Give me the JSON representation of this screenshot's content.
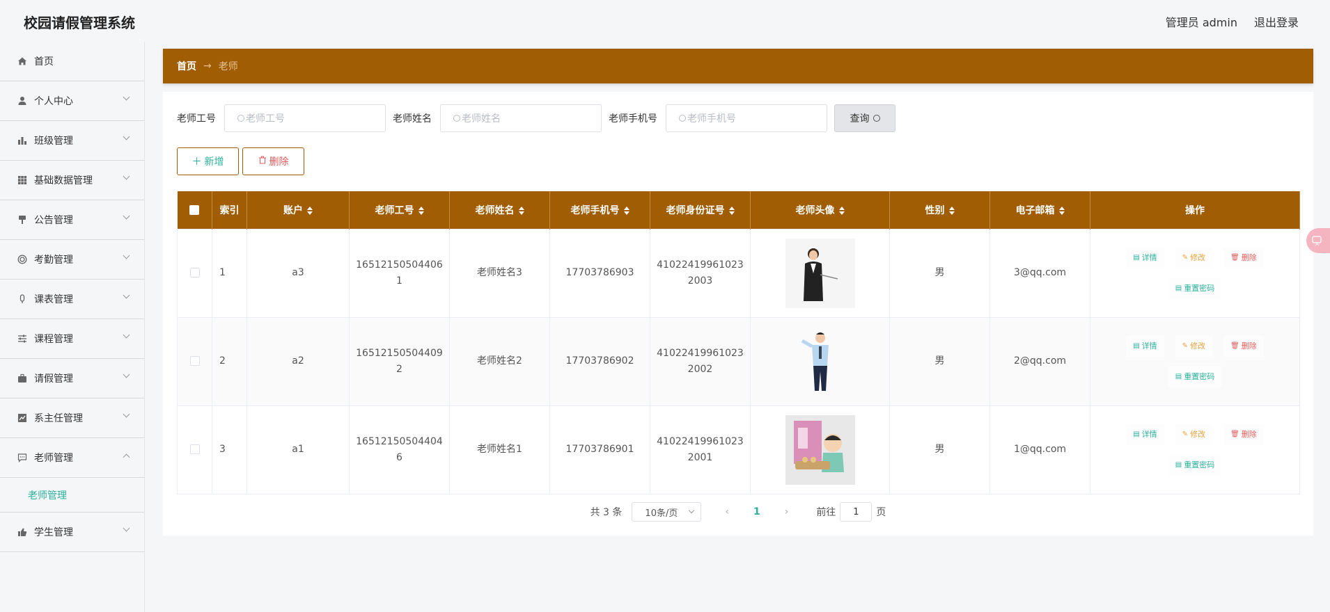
{
  "app": {
    "title": "校园请假管理系统"
  },
  "header": {
    "user": "管理员 admin",
    "logout": "退出登录"
  },
  "sidebar": {
    "items": [
      {
        "label": "首页",
        "icon": "home-icon"
      },
      {
        "label": "个人中心",
        "icon": "user-icon"
      },
      {
        "label": "班级管理",
        "icon": "bar-chart-icon"
      },
      {
        "label": "基础数据管理",
        "icon": "grid-icon"
      },
      {
        "label": "公告管理",
        "icon": "notice-icon"
      },
      {
        "label": "考勤管理",
        "icon": "circle-icon"
      },
      {
        "label": "课表管理",
        "icon": "mic-icon"
      },
      {
        "label": "课程管理",
        "icon": "sliders-icon"
      },
      {
        "label": "请假管理",
        "icon": "briefcase-icon"
      },
      {
        "label": "系主任管理",
        "icon": "trend-icon"
      },
      {
        "label": "老师管理",
        "icon": "chat-icon"
      },
      {
        "label": "学生管理",
        "icon": "thumb-icon"
      }
    ],
    "sub_active": "老师管理"
  },
  "breadcrumb": {
    "home": "首页",
    "sep": "→",
    "current": "老师"
  },
  "search": {
    "fields": [
      {
        "label": "老师工号",
        "placeholder": "老师工号"
      },
      {
        "label": "老师姓名",
        "placeholder": "老师姓名"
      },
      {
        "label": "老师手机号",
        "placeholder": "老师手机号"
      }
    ],
    "query_label": "查询"
  },
  "actions": {
    "add_label": "新增",
    "delete_label": "删除"
  },
  "table": {
    "headers": [
      "索引",
      "账户",
      "老师工号",
      "老师姓名",
      "老师手机号",
      "老师身份证号",
      "老师头像",
      "性别",
      "电子邮箱",
      "操作"
    ],
    "rows": [
      {
        "index": "1",
        "account": "a3",
        "teacher_no": "165121505044061",
        "name": "老师姓名3",
        "phone": "17703786903",
        "id_card": "410224199610232003",
        "gender": "男",
        "email": "3@qq.com"
      },
      {
        "index": "2",
        "account": "a2",
        "teacher_no": "165121505044092",
        "name": "老师姓名2",
        "phone": "17703786902",
        "id_card": "410224199610232002",
        "gender": "男",
        "email": "2@qq.com"
      },
      {
        "index": "3",
        "account": "a1",
        "teacher_no": "165121505044046",
        "name": "老师姓名1",
        "phone": "17703786901",
        "id_card": "410224199610232001",
        "gender": "男",
        "email": "1@qq.com"
      }
    ],
    "ops": {
      "detail": "详情",
      "edit": "修改",
      "delete": "删除",
      "reset": "重置密码"
    }
  },
  "pagination": {
    "total": "共 3 条",
    "page_size": "10条/页",
    "current": "1",
    "goto_label": "前往",
    "goto_value": "1",
    "page_suffix": "页"
  },
  "colors": {
    "accent": "#a15d03",
    "link": "#2bb19a",
    "danger": "#e65a5a",
    "warn": "#e6a23c"
  }
}
